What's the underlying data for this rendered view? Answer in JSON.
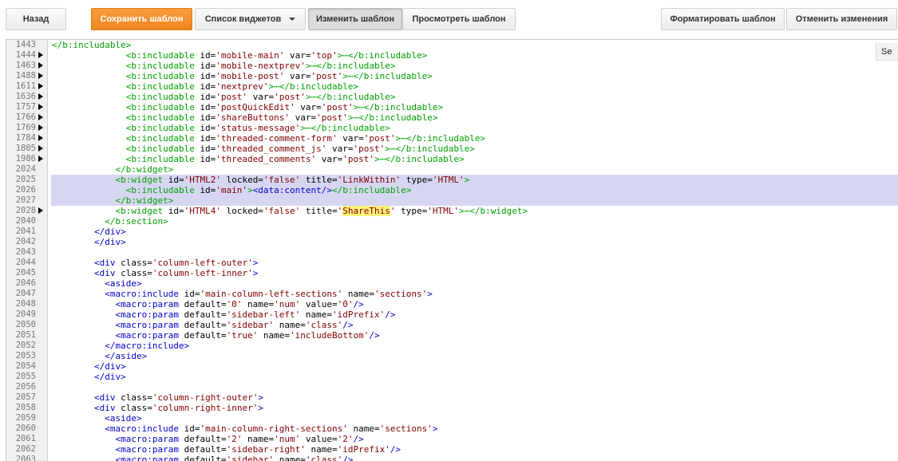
{
  "toolbar": {
    "back_label": "Назад",
    "save_label": "Сохранить шаблон",
    "widgets_label": "Список виджетов",
    "edit_label": "Изменить шаблон",
    "preview_label": "Просмотреть шаблон",
    "format_label": "Форматировать шаблон",
    "revert_label": "Отменить изменения"
  },
  "side_tab_label": "Se",
  "editor": {
    "lines": [
      {
        "n": "1443",
        "fold": false,
        "hl": false,
        "i": 0,
        "parts": [
          [
            "tgg",
            "</b:includable>"
          ]
        ]
      },
      {
        "n": "1444",
        "fold": true,
        "hl": false,
        "i": 14,
        "parts": [
          [
            "tgg",
            "<b:includable "
          ],
          [
            "at",
            "id="
          ],
          [
            "av",
            "'mobile-main'"
          ],
          [
            "at",
            " var="
          ],
          [
            "av",
            "'top'"
          ],
          [
            "tgg",
            ">⋯</b:includable>"
          ]
        ]
      },
      {
        "n": "1463",
        "fold": true,
        "hl": false,
        "i": 14,
        "parts": [
          [
            "tgg",
            "<b:includable "
          ],
          [
            "at",
            "id="
          ],
          [
            "av",
            "'mobile-nextprev'"
          ],
          [
            "tgg",
            ">⋯</b:includable>"
          ]
        ]
      },
      {
        "n": "1488",
        "fold": true,
        "hl": false,
        "i": 14,
        "parts": [
          [
            "tgg",
            "<b:includable "
          ],
          [
            "at",
            "id="
          ],
          [
            "av",
            "'mobile-post'"
          ],
          [
            "at",
            " var="
          ],
          [
            "av",
            "'post'"
          ],
          [
            "tgg",
            ">⋯</b:includable>"
          ]
        ]
      },
      {
        "n": "1611",
        "fold": true,
        "hl": false,
        "i": 14,
        "parts": [
          [
            "tgg",
            "<b:includable "
          ],
          [
            "at",
            "id="
          ],
          [
            "av",
            "'nextprev'"
          ],
          [
            "tgg",
            ">⋯</b:includable>"
          ]
        ]
      },
      {
        "n": "1636",
        "fold": true,
        "hl": false,
        "i": 14,
        "parts": [
          [
            "tgg",
            "<b:includable "
          ],
          [
            "at",
            "id="
          ],
          [
            "av",
            "'post'"
          ],
          [
            "at",
            " var="
          ],
          [
            "av",
            "'post'"
          ],
          [
            "tgg",
            ">⋯</b:includable>"
          ]
        ]
      },
      {
        "n": "1757",
        "fold": true,
        "hl": false,
        "i": 14,
        "parts": [
          [
            "tgg",
            "<b:includable "
          ],
          [
            "at",
            "id="
          ],
          [
            "av",
            "'postQuickEdit'"
          ],
          [
            "at",
            " var="
          ],
          [
            "av",
            "'post'"
          ],
          [
            "tgg",
            ">⋯</b:includable>"
          ]
        ]
      },
      {
        "n": "1766",
        "fold": true,
        "hl": false,
        "i": 14,
        "parts": [
          [
            "tgg",
            "<b:includable "
          ],
          [
            "at",
            "id="
          ],
          [
            "av",
            "'shareButtons'"
          ],
          [
            "at",
            " var="
          ],
          [
            "av",
            "'post'"
          ],
          [
            "tgg",
            ">⋯</b:includable>"
          ]
        ]
      },
      {
        "n": "1769",
        "fold": true,
        "hl": false,
        "i": 14,
        "parts": [
          [
            "tgg",
            "<b:includable "
          ],
          [
            "at",
            "id="
          ],
          [
            "av",
            "'status-message'"
          ],
          [
            "tgg",
            ">⋯</b:includable>"
          ]
        ]
      },
      {
        "n": "1784",
        "fold": true,
        "hl": false,
        "i": 14,
        "parts": [
          [
            "tgg",
            "<b:includable "
          ],
          [
            "at",
            "id="
          ],
          [
            "av",
            "'threaded-comment-form'"
          ],
          [
            "at",
            " var="
          ],
          [
            "av",
            "'post'"
          ],
          [
            "tgg",
            ">⋯</b:includable>"
          ]
        ]
      },
      {
        "n": "1805",
        "fold": true,
        "hl": false,
        "i": 14,
        "parts": [
          [
            "tgg",
            "<b:includable "
          ],
          [
            "at",
            "id="
          ],
          [
            "av",
            "'threaded_comment_js'"
          ],
          [
            "at",
            " var="
          ],
          [
            "av",
            "'post'"
          ],
          [
            "tgg",
            ">⋯</b:includable>"
          ]
        ]
      },
      {
        "n": "1986",
        "fold": true,
        "hl": false,
        "i": 14,
        "parts": [
          [
            "tgg",
            "<b:includable "
          ],
          [
            "at",
            "id="
          ],
          [
            "av",
            "'threaded_comments'"
          ],
          [
            "at",
            " var="
          ],
          [
            "av",
            "'post'"
          ],
          [
            "tgg",
            ">⋯</b:includable>"
          ]
        ]
      },
      {
        "n": "2024",
        "fold": false,
        "hl": false,
        "i": 12,
        "parts": [
          [
            "tgg",
            "</b:widget>"
          ]
        ]
      },
      {
        "n": "2025",
        "fold": false,
        "hl": true,
        "i": 12,
        "parts": [
          [
            "tgg",
            "<b:widget "
          ],
          [
            "at",
            "id="
          ],
          [
            "av",
            "'HTML2'"
          ],
          [
            "at",
            " locked="
          ],
          [
            "av",
            "'false'"
          ],
          [
            "at",
            " title="
          ],
          [
            "av",
            "'LinkWithin'"
          ],
          [
            "at",
            " type="
          ],
          [
            "av",
            "'HTML'"
          ],
          [
            "tgg",
            ">"
          ]
        ]
      },
      {
        "n": "2026",
        "fold": false,
        "hl": true,
        "i": 14,
        "parts": [
          [
            "tgg",
            "<b:includable "
          ],
          [
            "at",
            "id="
          ],
          [
            "av",
            "'main'"
          ],
          [
            "tgg",
            ">"
          ],
          [
            "mk",
            "<data:content/>"
          ],
          [
            "tgg",
            "</b:includable>"
          ]
        ]
      },
      {
        "n": "2027",
        "fold": false,
        "hl": true,
        "i": 12,
        "parts": [
          [
            "tgg",
            "</b:widget>"
          ]
        ]
      },
      {
        "n": "2028",
        "fold": true,
        "hl": false,
        "i": 12,
        "parts": [
          [
            "tgg",
            "<b:widget "
          ],
          [
            "at",
            "id="
          ],
          [
            "av",
            "'HTML4'"
          ],
          [
            "at",
            " locked="
          ],
          [
            "av",
            "'false'"
          ],
          [
            "at",
            " title="
          ],
          [
            "av",
            "'"
          ],
          [
            "avh",
            "ShareThis"
          ],
          [
            "av",
            "'"
          ],
          [
            "at",
            " type="
          ],
          [
            "av",
            "'HTML'"
          ],
          [
            "tgg",
            ">⋯</b:widget>"
          ]
        ]
      },
      {
        "n": "2040",
        "fold": false,
        "hl": false,
        "i": 10,
        "parts": [
          [
            "tgg",
            "</b:section>"
          ]
        ]
      },
      {
        "n": "2041",
        "fold": false,
        "hl": false,
        "i": 8,
        "parts": [
          [
            "tg",
            "</div>"
          ]
        ]
      },
      {
        "n": "2042",
        "fold": false,
        "hl": false,
        "i": 8,
        "parts": [
          [
            "tg",
            "</div>"
          ]
        ]
      },
      {
        "n": "2043",
        "fold": false,
        "hl": false,
        "i": 0,
        "parts": []
      },
      {
        "n": "2044",
        "fold": false,
        "hl": false,
        "i": 8,
        "parts": [
          [
            "tg",
            "<div "
          ],
          [
            "at",
            "class="
          ],
          [
            "av",
            "'column-left-outer'"
          ],
          [
            "tg",
            ">"
          ]
        ]
      },
      {
        "n": "2045",
        "fold": false,
        "hl": false,
        "i": 8,
        "parts": [
          [
            "tg",
            "<div "
          ],
          [
            "at",
            "class="
          ],
          [
            "av",
            "'column-left-inner'"
          ],
          [
            "tg",
            ">"
          ]
        ]
      },
      {
        "n": "2046",
        "fold": false,
        "hl": false,
        "i": 10,
        "parts": [
          [
            "tg",
            "<aside>"
          ]
        ]
      },
      {
        "n": "2047",
        "fold": false,
        "hl": false,
        "i": 10,
        "parts": [
          [
            "tg",
            "<macro:include "
          ],
          [
            "at",
            "id="
          ],
          [
            "av",
            "'main-column-left-sections'"
          ],
          [
            "at",
            " name="
          ],
          [
            "av",
            "'sections'"
          ],
          [
            "tg",
            ">"
          ]
        ]
      },
      {
        "n": "2048",
        "fold": false,
        "hl": false,
        "i": 12,
        "parts": [
          [
            "tg",
            "<macro:param "
          ],
          [
            "at",
            "default="
          ],
          [
            "av",
            "'0'"
          ],
          [
            "at",
            " name="
          ],
          [
            "av",
            "'num'"
          ],
          [
            "at",
            " value="
          ],
          [
            "av",
            "'0'"
          ],
          [
            "tg",
            "/>"
          ]
        ]
      },
      {
        "n": "2049",
        "fold": false,
        "hl": false,
        "i": 12,
        "parts": [
          [
            "tg",
            "<macro:param "
          ],
          [
            "at",
            "default="
          ],
          [
            "av",
            "'sidebar-left'"
          ],
          [
            "at",
            " name="
          ],
          [
            "av",
            "'idPrefix'"
          ],
          [
            "tg",
            "/>"
          ]
        ]
      },
      {
        "n": "2050",
        "fold": false,
        "hl": false,
        "i": 12,
        "parts": [
          [
            "tg",
            "<macro:param "
          ],
          [
            "at",
            "default="
          ],
          [
            "av",
            "'sidebar'"
          ],
          [
            "at",
            " name="
          ],
          [
            "av",
            "'class'"
          ],
          [
            "tg",
            "/>"
          ]
        ]
      },
      {
        "n": "2051",
        "fold": false,
        "hl": false,
        "i": 12,
        "parts": [
          [
            "tg",
            "<macro:param "
          ],
          [
            "at",
            "default="
          ],
          [
            "av",
            "'true'"
          ],
          [
            "at",
            " name="
          ],
          [
            "av",
            "'includeBottom'"
          ],
          [
            "tg",
            "/>"
          ]
        ]
      },
      {
        "n": "2052",
        "fold": false,
        "hl": false,
        "i": 10,
        "parts": [
          [
            "tg",
            "</macro:include>"
          ]
        ]
      },
      {
        "n": "2053",
        "fold": false,
        "hl": false,
        "i": 10,
        "parts": [
          [
            "tg",
            "</aside>"
          ]
        ]
      },
      {
        "n": "2054",
        "fold": false,
        "hl": false,
        "i": 8,
        "parts": [
          [
            "tg",
            "</div>"
          ]
        ]
      },
      {
        "n": "2055",
        "fold": false,
        "hl": false,
        "i": 8,
        "parts": [
          [
            "tg",
            "</div>"
          ]
        ]
      },
      {
        "n": "2056",
        "fold": false,
        "hl": false,
        "i": 0,
        "parts": []
      },
      {
        "n": "2057",
        "fold": false,
        "hl": false,
        "i": 8,
        "parts": [
          [
            "tg",
            "<div "
          ],
          [
            "at",
            "class="
          ],
          [
            "av",
            "'column-right-outer'"
          ],
          [
            "tg",
            ">"
          ]
        ]
      },
      {
        "n": "2058",
        "fold": false,
        "hl": false,
        "i": 8,
        "parts": [
          [
            "tg",
            "<div "
          ],
          [
            "at",
            "class="
          ],
          [
            "av",
            "'column-right-inner'"
          ],
          [
            "tg",
            ">"
          ]
        ]
      },
      {
        "n": "2059",
        "fold": false,
        "hl": false,
        "i": 10,
        "parts": [
          [
            "tg",
            "<aside>"
          ]
        ]
      },
      {
        "n": "2060",
        "fold": false,
        "hl": false,
        "i": 10,
        "parts": [
          [
            "tg",
            "<macro:include "
          ],
          [
            "at",
            "id="
          ],
          [
            "av",
            "'main-column-right-sections'"
          ],
          [
            "at",
            " name="
          ],
          [
            "av",
            "'sections'"
          ],
          [
            "tg",
            ">"
          ]
        ]
      },
      {
        "n": "2061",
        "fold": false,
        "hl": false,
        "i": 12,
        "parts": [
          [
            "tg",
            "<macro:param "
          ],
          [
            "at",
            "default="
          ],
          [
            "av",
            "'2'"
          ],
          [
            "at",
            " name="
          ],
          [
            "av",
            "'num'"
          ],
          [
            "at",
            " value="
          ],
          [
            "av",
            "'2'"
          ],
          [
            "tg",
            "/>"
          ]
        ]
      },
      {
        "n": "2062",
        "fold": false,
        "hl": false,
        "i": 12,
        "parts": [
          [
            "tg",
            "<macro:param "
          ],
          [
            "at",
            "default="
          ],
          [
            "av",
            "'sidebar-right'"
          ],
          [
            "at",
            " name="
          ],
          [
            "av",
            "'idPrefix'"
          ],
          [
            "tg",
            "/>"
          ]
        ]
      },
      {
        "n": "2063",
        "fold": false,
        "hl": false,
        "i": 12,
        "parts": [
          [
            "tg",
            "<macro:param "
          ],
          [
            "at",
            "default="
          ],
          [
            "av",
            "'sidebar'"
          ],
          [
            "at",
            " name="
          ],
          [
            "av",
            "'class'"
          ],
          [
            "tg",
            "/>"
          ]
        ]
      }
    ]
  }
}
